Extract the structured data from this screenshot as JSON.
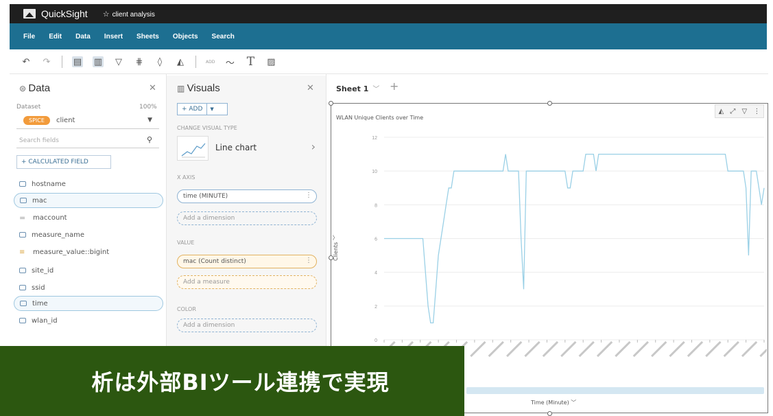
{
  "app": {
    "name": "QuickSight",
    "analysis_name": "client analysis"
  },
  "menu": [
    "File",
    "Edit",
    "Data",
    "Insert",
    "Sheets",
    "Objects",
    "Search"
  ],
  "toolbar": {
    "icons": [
      "undo-icon",
      "redo-icon",
      "data-panel-icon",
      "visuals-icon",
      "filter-icon",
      "parameters-icon",
      "insights-icon",
      "themes-icon",
      "add-label",
      "line-icon",
      "text-icon",
      "image-icon"
    ],
    "add_label": "ADD"
  },
  "data_panel": {
    "title": "Data",
    "dataset_label": "Dataset",
    "spice_percent": "100%",
    "spice_badge": "SPICE",
    "dataset_name": "client",
    "search_placeholder": "Search fields",
    "calc_field_label": "+ CALCULATED FIELD",
    "fields": [
      {
        "name": "hostname",
        "kind": "dimension",
        "selected": false
      },
      {
        "name": "mac",
        "kind": "dimension",
        "selected": true
      },
      {
        "name": "maccount",
        "kind": "measure-eq",
        "selected": false
      },
      {
        "name": "measure_name",
        "kind": "dimension",
        "selected": false
      },
      {
        "name": "measure_value::bigint",
        "kind": "measure",
        "selected": false
      },
      {
        "name": "site_id",
        "kind": "dimension",
        "selected": false
      },
      {
        "name": "ssid",
        "kind": "dimension",
        "selected": false
      },
      {
        "name": "time",
        "kind": "dimension",
        "selected": true
      },
      {
        "name": "wlan_id",
        "kind": "dimension",
        "selected": false
      }
    ]
  },
  "visuals_panel": {
    "title": "Visuals",
    "add_label": "+ ADD",
    "change_type_label": "CHANGE VISUAL TYPE",
    "visual_type": "Line chart",
    "x_axis_label": "X AXIS",
    "x_axis_field": "time (MINUTE)",
    "x_axis_add": "Add a dimension",
    "value_label": "VALUE",
    "value_field": "mac (Count distinct)",
    "value_add": "Add a measure",
    "color_label": "COLOR",
    "color_add": "Add a dimension"
  },
  "sheet": {
    "tab_label": "Sheet 1",
    "add_label": "+"
  },
  "visual": {
    "title": "WLAN Unique Clients over Time",
    "x_title": "Time (Minute)",
    "y_title": "Clients"
  },
  "chart_data": {
    "type": "line",
    "ylim": [
      0,
      12
    ],
    "yticks": [
      0,
      2,
      4,
      6,
      8,
      10,
      12
    ],
    "line_color": "#9ad0e6",
    "series": [
      {
        "values": [
          6,
          6,
          6,
          6,
          6,
          6,
          6,
          6,
          6,
          6,
          6,
          6,
          6,
          6,
          6,
          6,
          4,
          2,
          1,
          1,
          3,
          5,
          6,
          7,
          8,
          9,
          9,
          10,
          10,
          10,
          10,
          10,
          10,
          10,
          10,
          10,
          10,
          10,
          10,
          10,
          10,
          10,
          10,
          10,
          10,
          10,
          10,
          11,
          10,
          10,
          10,
          10,
          10,
          6,
          3,
          10,
          10,
          10,
          10,
          10,
          10,
          10,
          10,
          10,
          10,
          10,
          10,
          10,
          10,
          10,
          10,
          9,
          9,
          10,
          10,
          10,
          10,
          10,
          11,
          11,
          11,
          11,
          10,
          11,
          11,
          11,
          11,
          11,
          11,
          11,
          11,
          11,
          11,
          11,
          11,
          11,
          11,
          11,
          11,
          11,
          11,
          11,
          11,
          11,
          11,
          11,
          11,
          11,
          11,
          11,
          11,
          11,
          11,
          11,
          11,
          11,
          11,
          11,
          11,
          11,
          11,
          11,
          11,
          11,
          11,
          11,
          11,
          11,
          11,
          11,
          11,
          11,
          11,
          10,
          10,
          10,
          10,
          10,
          10,
          10,
          9,
          5,
          10,
          10,
          10,
          9,
          8,
          9
        ]
      }
    ],
    "x_tick_count": 22
  },
  "banner": {
    "text": "析は外部BIツール連携で実現"
  }
}
